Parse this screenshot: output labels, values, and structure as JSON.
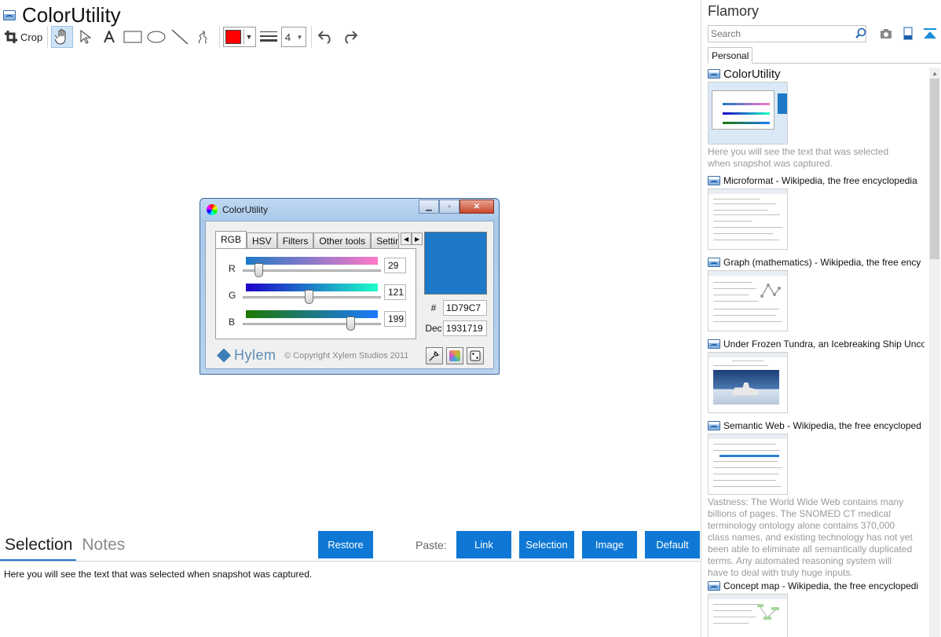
{
  "main": {
    "title": "ColorUtility",
    "toolbar": {
      "crop_label": "Crop",
      "stroke_width": "4",
      "color": "#ff0000"
    }
  },
  "window": {
    "title": "ColorUtility",
    "tabs": [
      "RGB",
      "HSV",
      "Filters",
      "Other tools",
      "Setting"
    ],
    "sliders": [
      {
        "label": "R",
        "value": "29",
        "fraction": 0.114
      },
      {
        "label": "G",
        "value": "121",
        "fraction": 0.475
      },
      {
        "label": "B",
        "value": "199",
        "fraction": 0.78
      }
    ],
    "hex_label": "#",
    "hex_value": "1D79C7",
    "dec_label": "Dec",
    "dec_value": "1931719",
    "swatch_color": "#1d79c7",
    "brand": "Hylem",
    "copyright": "© Copyright Xylem Studios 2011"
  },
  "bottom": {
    "tabs": [
      "Selection",
      "Notes"
    ],
    "restore_label": "Restore",
    "paste_label": "Paste:",
    "paste_buttons": [
      "Link",
      "Selection",
      "Image",
      "Default"
    ],
    "selection_text": "Here you will see the text that was selected when snapshot was captured."
  },
  "sidebar": {
    "title": "Flamory",
    "search_placeholder": "Search",
    "tab": "Personal",
    "items": [
      {
        "title": "ColorUtility",
        "desc": "Here you will see the text that was selected when snapshot was captured."
      },
      {
        "title": "Microformat - Wikipedia, the free encyclopedia",
        "desc": ""
      },
      {
        "title": "Graph (mathematics) - Wikipedia, the free ency",
        "desc": ""
      },
      {
        "title": "Under Frozen Tundra, an Icebreaking Ship Unco",
        "desc": ""
      },
      {
        "title": "Semantic Web - Wikipedia, the free encycloped",
        "desc": "Vastness: The World Wide Web contains many billions of pages. The SNOMED CT medical terminology ontology alone contains 370,000 class names, and existing technology has not yet been able to eliminate all semantically duplicated terms. Any automated reasoning system will have to deal with truly huge inputs."
      },
      {
        "title": "Concept map - Wikipedia, the free encyclopedi",
        "desc": ""
      }
    ]
  },
  "colors": {
    "accent": "#0e78d4",
    "swatch": "#1d79c7"
  }
}
